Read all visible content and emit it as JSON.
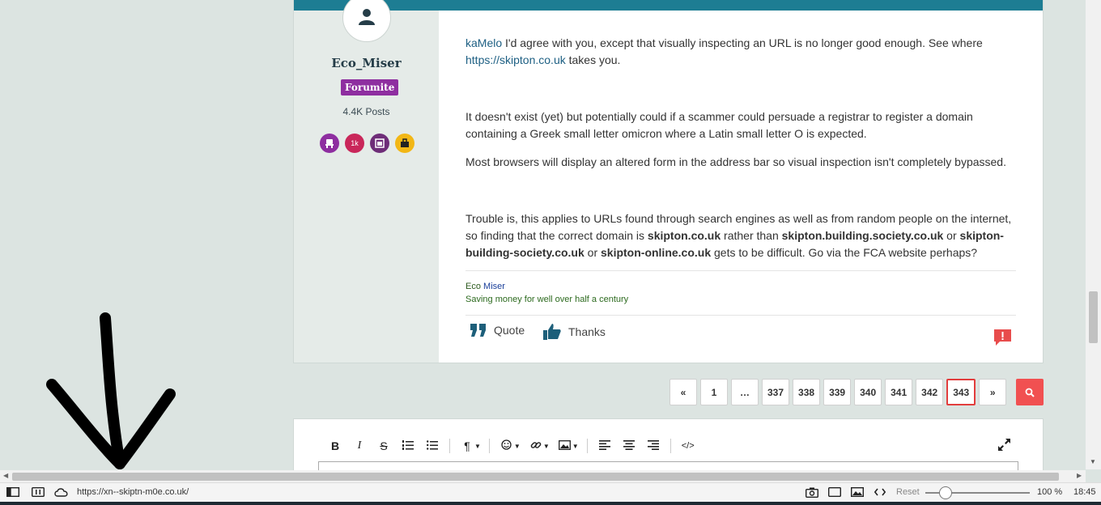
{
  "author": {
    "name": "Eco_Miser",
    "role": "Forumite",
    "posts": "4.4K Posts",
    "badges": [
      {
        "icon": "chair-icon",
        "label": ""
      },
      {
        "icon": "thousand-badge-icon",
        "label": "1k"
      },
      {
        "icon": "calendar-badge-icon",
        "label": ""
      },
      {
        "icon": "shopping-badge-icon",
        "label": ""
      }
    ]
  },
  "post": {
    "p1_mention": "kaMelo",
    "p1_text": " I'd agree with you, except that visually inspecting an URL is no longer good enough. See where",
    "p1_link": "https://skipton.co.uk",
    "p1_tail": " takes you.",
    "p2": "It doesn't exist (yet) but potentially could if a scammer could persuade a registrar to register a domain containing a Greek small letter omicron where a Latin small letter O is expected.",
    "p3": "Most browsers will display an altered form in the address bar so visual inspection isn't completely bypassed.",
    "p4_a": "Trouble is, this applies to URLs found through search engines as well as from random people on the internet, so finding that the correct domain is  ",
    "p4_b1": "skipton.co.uk",
    "p4_c": " rather than ",
    "p4_b2": "skipton.building.society.co.uk",
    "p4_d": " or ",
    "p4_b3": "skipton-building-society.co.uk",
    "p4_e": " or ",
    "p4_b4": "skipton-online.co.uk",
    "p4_f": " gets to be difficult. Go via the FCA website perhaps?"
  },
  "signature": {
    "name_part1": "Eco",
    "name_part2": " Miser",
    "motto": "Saving money for well over half a century"
  },
  "actions": {
    "quote": "Quote",
    "thanks": "Thanks"
  },
  "pagination": {
    "prev": "«",
    "first": "1",
    "ellipsis": "…",
    "pages": [
      "337",
      "338",
      "339",
      "340",
      "341",
      "342"
    ],
    "current": "343",
    "next": "»"
  },
  "editor_toolbar": {
    "bold": "B",
    "italic": "I",
    "strike": "S",
    "paragraph": "¶",
    "code": "</>"
  },
  "statusbar": {
    "url": "https://xn--skiptn-m0e.co.uk/",
    "reset": "Reset",
    "zoom": "100 %",
    "time": "18:45"
  },
  "colors": {
    "accent": "#1d7d93",
    "role": "#8e2ea0",
    "search": "#f15051",
    "current_page_border": "#e23d3d"
  }
}
